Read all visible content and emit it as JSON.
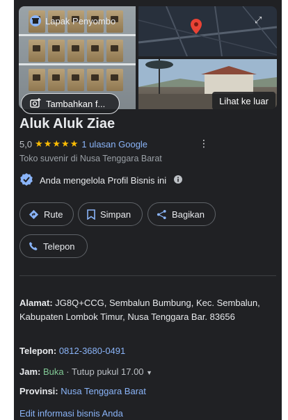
{
  "photos": {
    "add_photo_label": "Tambahkan f...",
    "map_place_label": "Lapak Penyombo",
    "outside_view_label": "Lihat ke luar"
  },
  "business": {
    "name": "Aluk Aluk Ziae",
    "rating": "5,0",
    "stars": "★★★★★",
    "reviews_link": "1 ulasan Google",
    "category": "Toko suvenir di Nusa Tenggara Barat",
    "manage_text": "Anda mengelola Profil Bisnis ini"
  },
  "actions": {
    "route": "Rute",
    "save": "Simpan",
    "share": "Bagikan",
    "call": "Telepon"
  },
  "details": {
    "address_label": "Alamat:",
    "address_value": " JG8Q+CCG, Sembalun Bumbung, Kec. Sembalun, Kabupaten Lombok Timur, Nusa Tenggara Bar. 83656",
    "phone_label": "Telepon:",
    "phone_value": "0812-3680-0491",
    "hours_label": "Jam:",
    "hours_status": "Buka",
    "hours_close": " · Tutup pukul 17.00",
    "province_label": "Provinsi:",
    "province_value": "Nusa Tenggara Barat"
  },
  "edit_link": "Edit informasi bisnis Anda",
  "colors": {
    "panel_bg": "#202124",
    "accent_blue": "#8ab4f8",
    "star_yellow": "#fbbc04",
    "open_green": "#81c995",
    "map_pin_red": "#ea4335"
  }
}
